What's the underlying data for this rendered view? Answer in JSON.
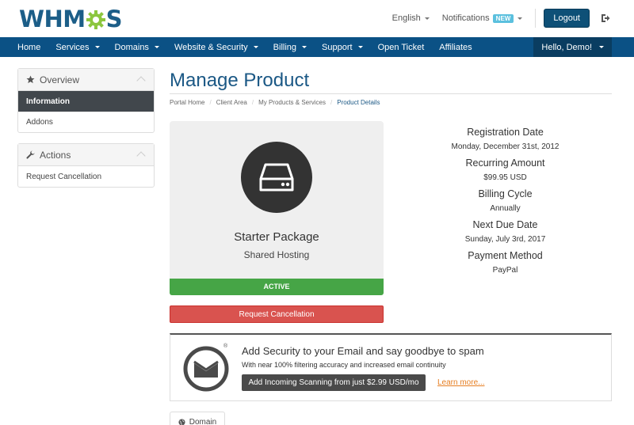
{
  "header": {
    "logo_left": "WHM",
    "logo_right": "S",
    "language": "English",
    "notifications": "Notifications",
    "new_badge": "NEW",
    "logout": "Logout"
  },
  "nav": {
    "items": [
      {
        "label": "Home",
        "dropdown": false
      },
      {
        "label": "Services",
        "dropdown": true
      },
      {
        "label": "Domains",
        "dropdown": true
      },
      {
        "label": "Website & Security",
        "dropdown": true
      },
      {
        "label": "Billing",
        "dropdown": true
      },
      {
        "label": "Support",
        "dropdown": true
      },
      {
        "label": "Open Ticket",
        "dropdown": false
      },
      {
        "label": "Affiliates",
        "dropdown": false
      }
    ],
    "user": "Hello, Demo!"
  },
  "sidebar": {
    "overview": {
      "title": "Overview",
      "items": [
        "Information",
        "Addons"
      ],
      "active": "Information"
    },
    "actions": {
      "title": "Actions",
      "items": [
        "Request Cancellation"
      ]
    }
  },
  "page": {
    "title": "Manage Product",
    "breadcrumb": [
      "Portal Home",
      "Client Area",
      "My Products & Services",
      "Product Details"
    ]
  },
  "product": {
    "name": "Starter Package",
    "group": "Shared Hosting",
    "status": "ACTIVE",
    "cancel_button": "Request Cancellation"
  },
  "details": [
    {
      "label": "Registration Date",
      "value": "Monday, December 31st, 2012"
    },
    {
      "label": "Recurring Amount",
      "value": "$99.95 USD"
    },
    {
      "label": "Billing Cycle",
      "value": "Annually"
    },
    {
      "label": "Next Due Date",
      "value": "Sunday, July 3rd, 2017"
    },
    {
      "label": "Payment Method",
      "value": "PayPal"
    }
  ],
  "promo": {
    "headline": "Add Security to your Email and say goodbye to spam",
    "subtext": "With near 100% filtering accuracy and increased email continuity",
    "button": "Add Incoming Scanning from just $2.99 USD/mo",
    "link": "Learn more...",
    "registered_mark": "®"
  },
  "tabs": {
    "domain": "Domain"
  },
  "colors": {
    "brand_blue": "#1b5885",
    "nav_blue": "#0b5185",
    "active_green": "#46a546",
    "danger_red": "#d9534f",
    "gear_green": "#8cc63f"
  }
}
